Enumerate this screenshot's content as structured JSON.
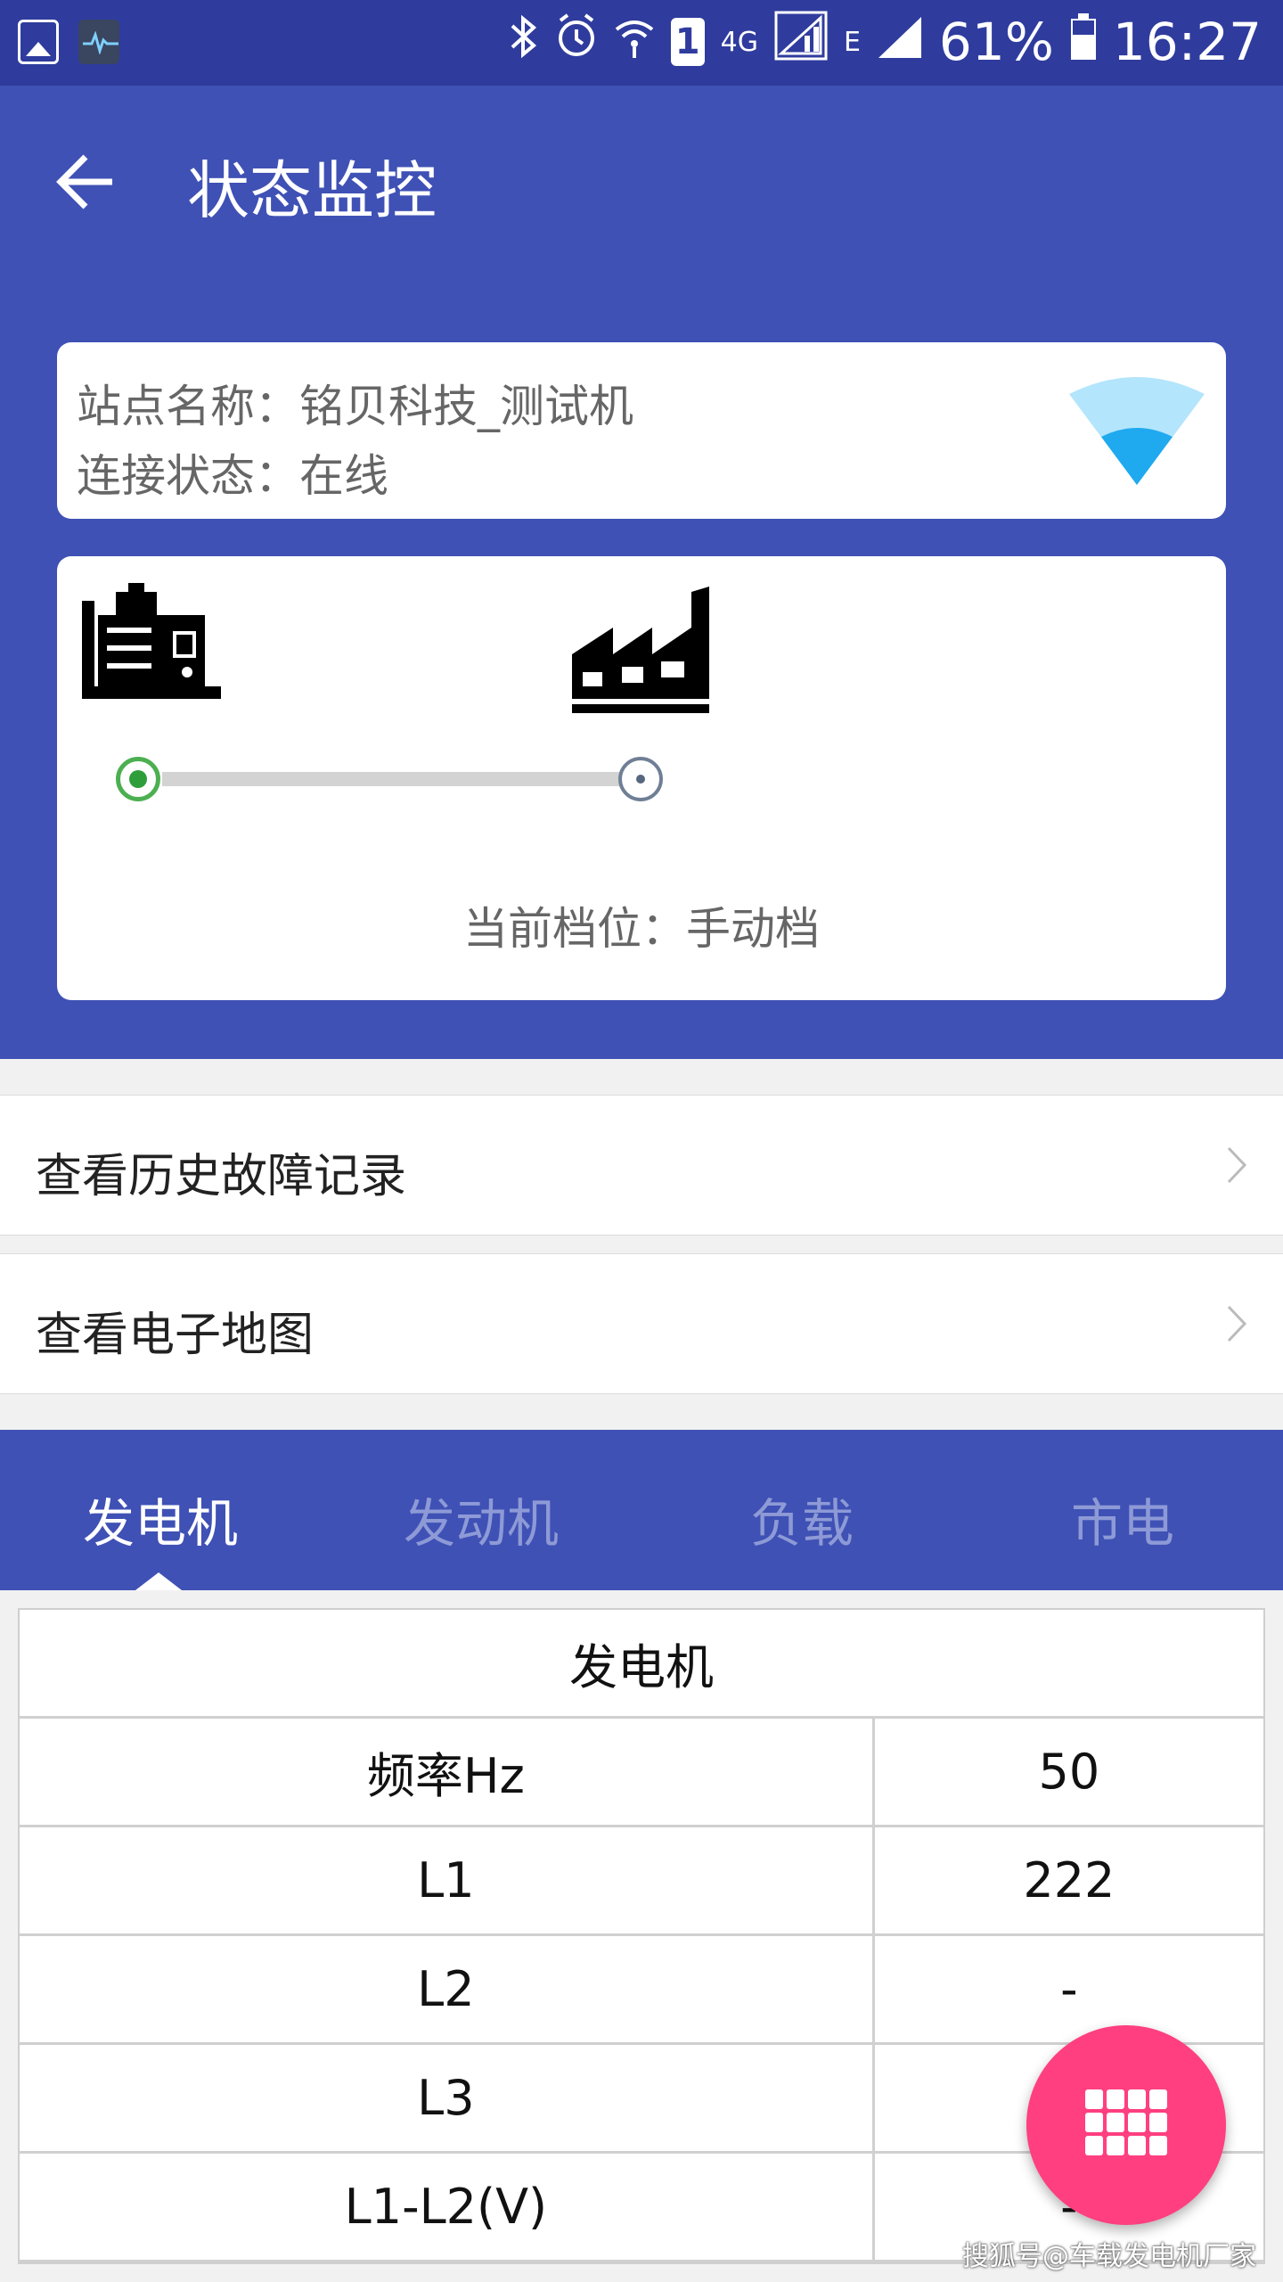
{
  "status_bar": {
    "battery_percent": "61%",
    "time": "16:27",
    "network_4g": "4G",
    "network_e": "E",
    "sim_slot": "1"
  },
  "app_bar": {
    "title": "状态监控"
  },
  "station": {
    "name_line": "站点名称：铭贝科技_测试机",
    "status_line": "连接状态：在线"
  },
  "power_flow": {
    "gear_text": "当前档位：手动档"
  },
  "menu": {
    "history": "查看历史故障记录",
    "map": "查看电子地图"
  },
  "tabs": [
    "发电机",
    "发动机",
    "负载",
    "市电"
  ],
  "active_tab": 0,
  "table": {
    "title": "发电机",
    "rows": [
      {
        "label": "频率Hz",
        "value": "50"
      },
      {
        "label": "L1",
        "value": "222"
      },
      {
        "label": "L2",
        "value": "-"
      },
      {
        "label": "L3",
        "value": "-"
      },
      {
        "label": "L1-L2(V)",
        "value": "-"
      }
    ]
  },
  "watermark": "搜狐号@车载发电机厂家",
  "colors": {
    "primary": "#3f51b5",
    "status_bar": "#2f3c9e",
    "fab": "#ff3f7f",
    "wifi": "#29b6f6",
    "online_green": "#4caf50"
  }
}
